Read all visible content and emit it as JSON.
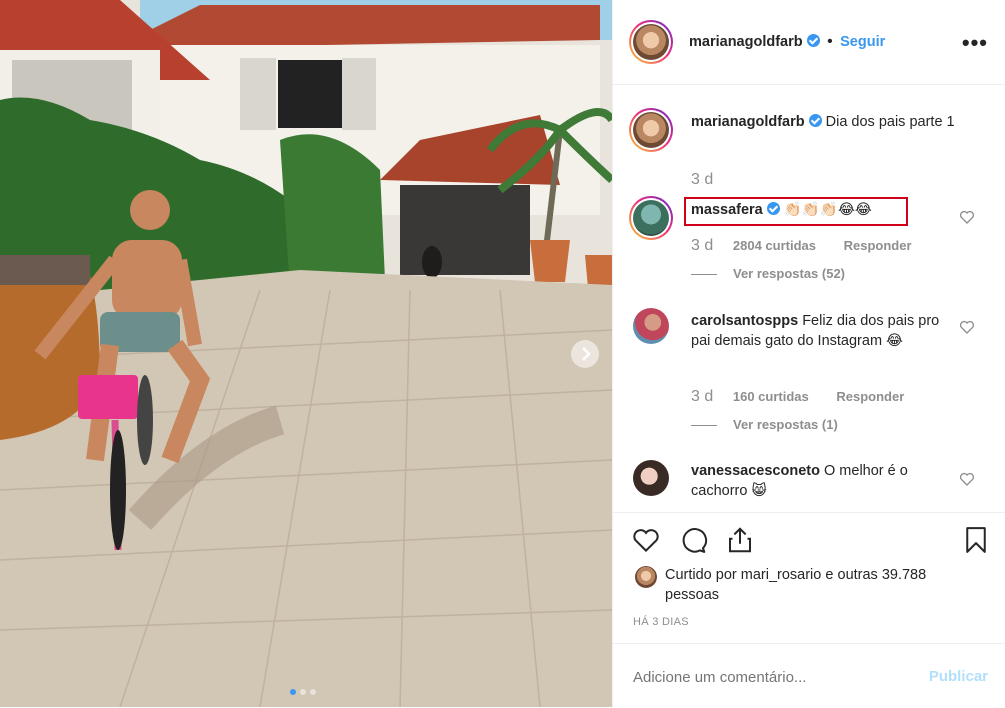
{
  "post": {
    "author": "marianagoldfarb",
    "follow_label": "Seguir",
    "more_label": "•••",
    "caption_user": "marianagoldfarb",
    "caption_text": "Dia dos pais parte 1",
    "caption_time": "3 d",
    "photo_index": 1,
    "photo_count": 3
  },
  "comments": [
    {
      "user": "massafera",
      "verified": true,
      "text": "👏🏻👏🏻👏🏻😂😂",
      "time": "3 d",
      "likes": "2804 curtidas",
      "reply_label": "Responder",
      "replies_label": "Ver respostas (52)",
      "highlighted": true
    },
    {
      "user": "carolsantospps",
      "verified": false,
      "text": "Feliz dia dos pais pro pai demais gato do Instagram 😂",
      "time": "3 d",
      "likes": "160 curtidas",
      "reply_label": "Responder",
      "replies_label": "Ver respostas (1)"
    },
    {
      "user": "vanessacesconeto",
      "verified": false,
      "text": "O melhor é o cachorro 😸"
    }
  ],
  "likes": {
    "prefix": "Curtido por",
    "user": "mari_rosario",
    "joiner": "e",
    "others": "outras 39.788 pessoas",
    "date": "HÁ 3 DIAS"
  },
  "add_comment": {
    "placeholder": "Adicione um comentário...",
    "publish_label": "Publicar"
  },
  "icons": {
    "like": "heart-icon",
    "comment": "comment-icon",
    "share": "share-icon",
    "save": "bookmark-icon",
    "next": "chevron-right-icon",
    "more": "more-icon"
  },
  "colors": {
    "link": "#3897f0",
    "highlight": "#d0021b",
    "muted": "#8e8e8e"
  }
}
